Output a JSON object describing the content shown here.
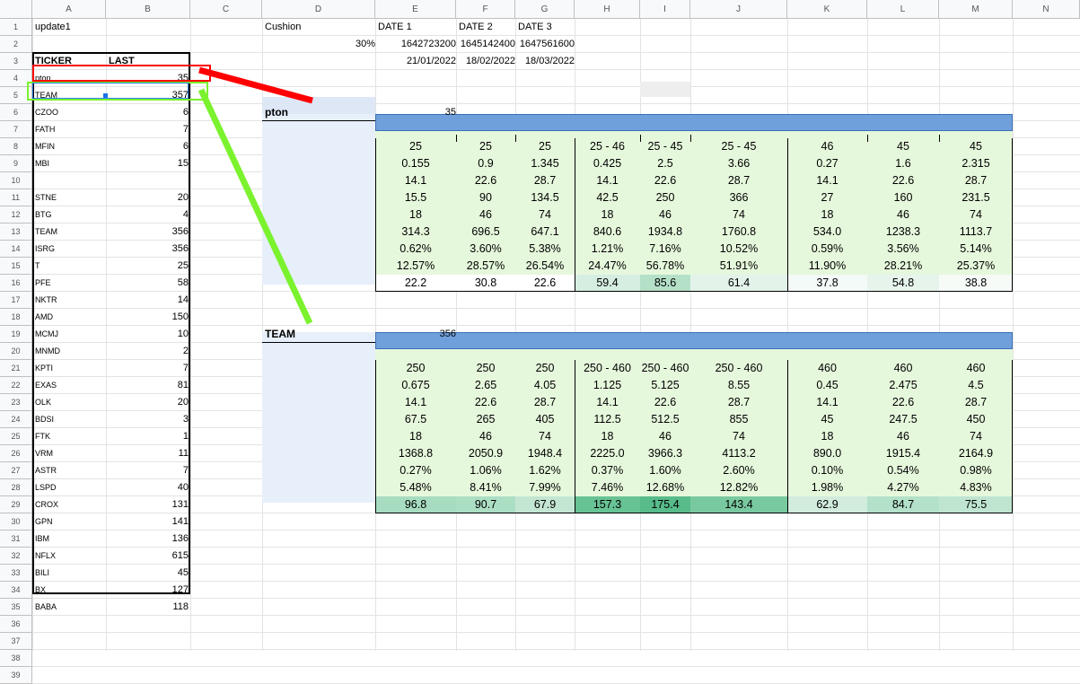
{
  "columns": [
    "A",
    "B",
    "C",
    "D",
    "E",
    "F",
    "G",
    "H",
    "I",
    "J",
    "K",
    "L",
    "M",
    "N"
  ],
  "rows": [
    "1",
    "2",
    "3",
    "4",
    "5",
    "6",
    "7",
    "8",
    "9",
    "10",
    "11",
    "12",
    "13",
    "14",
    "15",
    "16",
    "17",
    "18",
    "19",
    "20",
    "21",
    "22",
    "23",
    "24",
    "25",
    "26",
    "27",
    "28",
    "29",
    "30",
    "31",
    "32",
    "33",
    "34",
    "35",
    "36",
    "37",
    "38",
    "39"
  ],
  "sheet_name": "update1",
  "ticker_header": "TICKER",
  "last_header": "LAST",
  "tickers": [
    {
      "t": "pton",
      "v": "35"
    },
    {
      "t": "TEAM",
      "v": "357"
    },
    {
      "t": "CZOO",
      "v": "6"
    },
    {
      "t": "FATH",
      "v": "7"
    },
    {
      "t": "MFIN",
      "v": "6"
    },
    {
      "t": "MBI",
      "v": "15"
    },
    {
      "t": "",
      "v": ""
    },
    {
      "t": "STNE",
      "v": "20"
    },
    {
      "t": "BTG",
      "v": "4"
    },
    {
      "t": "TEAM",
      "v": "356"
    },
    {
      "t": "ISRG",
      "v": "356"
    },
    {
      "t": "T",
      "v": "25"
    },
    {
      "t": "PFE",
      "v": "58"
    },
    {
      "t": "NKTR",
      "v": "14"
    },
    {
      "t": "AMD",
      "v": "150"
    },
    {
      "t": "MCMJ",
      "v": "10"
    },
    {
      "t": "MNMD",
      "v": "2"
    },
    {
      "t": "KPTI",
      "v": "7"
    },
    {
      "t": "EXAS",
      "v": "81"
    },
    {
      "t": "OLK",
      "v": "20"
    },
    {
      "t": "BDSI",
      "v": "3"
    },
    {
      "t": "FTK",
      "v": "1"
    },
    {
      "t": "VRM",
      "v": "11"
    },
    {
      "t": "ASTR",
      "v": "7"
    },
    {
      "t": "LSPD",
      "v": "40"
    },
    {
      "t": "CROX",
      "v": "131"
    },
    {
      "t": "GPN",
      "v": "141"
    },
    {
      "t": "IBM",
      "v": "136"
    },
    {
      "t": "NFLX",
      "v": "615"
    },
    {
      "t": "BILI",
      "v": "45"
    },
    {
      "t": "BX",
      "v": "127"
    },
    {
      "t": "BABA",
      "v": "118"
    }
  ],
  "cushion_label": "Cushion",
  "cushion_value": "30%",
  "dates": [
    {
      "label": "DATE 1",
      "ts": "1642723200",
      "d": "21/01/2022"
    },
    {
      "label": "DATE 2",
      "ts": "1645142400",
      "d": "18/02/2022"
    },
    {
      "label": "DATE 3",
      "ts": "1647561600",
      "d": "18/03/2022"
    }
  ],
  "sections": [
    {
      "name": "pton",
      "value": "35",
      "rows": [
        [
          "25",
          "25",
          "25",
          "25 - 46",
          "25 - 45",
          "25 - 45",
          "46",
          "45",
          "45"
        ],
        [
          "0.155",
          "0.9",
          "1.345",
          "0.425",
          "2.5",
          "3.66",
          "0.27",
          "1.6",
          "2.315"
        ],
        [
          "14.1",
          "22.6",
          "28.7",
          "14.1",
          "22.6",
          "28.7",
          "14.1",
          "22.6",
          "28.7"
        ],
        [
          "15.5",
          "90",
          "134.5",
          "42.5",
          "250",
          "366",
          "27",
          "160",
          "231.5"
        ],
        [
          "18",
          "46",
          "74",
          "18",
          "46",
          "74",
          "18",
          "46",
          "74"
        ],
        [
          "314.3",
          "696.5",
          "647.1",
          "840.6",
          "1934.8",
          "1760.8",
          "534.0",
          "1238.3",
          "1113.7"
        ],
        [
          "0.62%",
          "3.60%",
          "5.38%",
          "1.21%",
          "7.16%",
          "10.52%",
          "0.59%",
          "3.56%",
          "5.14%"
        ],
        [
          "12.57%",
          "28.57%",
          "26.54%",
          "24.47%",
          "56.78%",
          "51.91%",
          "11.90%",
          "28.21%",
          "25.37%"
        ],
        [
          "22.2",
          "30.8",
          "22.6",
          "59.4",
          "85.6",
          "61.4",
          "37.8",
          "54.8",
          "38.8"
        ]
      ],
      "last_colors": [
        "#ffffff",
        "#ffffff",
        "#ffffff",
        "#d6eee2",
        "#b4e0c8",
        "#e3f3ea",
        "#f4faf7",
        "#e6f4ec",
        "#f6fbf8"
      ]
    },
    {
      "name": "TEAM",
      "value": "356",
      "rows": [
        [
          "250",
          "250",
          "250",
          "250 - 460",
          "250 - 460",
          "250 - 460",
          "460",
          "460",
          "460"
        ],
        [
          "0.675",
          "2.65",
          "4.05",
          "1.125",
          "5.125",
          "8.55",
          "0.45",
          "2.475",
          "4.5"
        ],
        [
          "14.1",
          "22.6",
          "28.7",
          "14.1",
          "22.6",
          "28.7",
          "14.1",
          "22.6",
          "28.7"
        ],
        [
          "67.5",
          "265",
          "405",
          "112.5",
          "512.5",
          "855",
          "45",
          "247.5",
          "450"
        ],
        [
          "18",
          "46",
          "74",
          "18",
          "46",
          "74",
          "18",
          "46",
          "74"
        ],
        [
          "1368.8",
          "2050.9",
          "1948.4",
          "2225.0",
          "3966.3",
          "4113.2",
          "890.0",
          "1915.4",
          "2164.9"
        ],
        [
          "0.27%",
          "1.06%",
          "1.62%",
          "0.37%",
          "1.60%",
          "2.60%",
          "0.10%",
          "0.54%",
          "0.98%"
        ],
        [
          "5.48%",
          "8.41%",
          "7.99%",
          "7.46%",
          "12.68%",
          "12.82%",
          "1.98%",
          "4.27%",
          "4.83%"
        ],
        [
          "96.8",
          "90.7",
          "67.9",
          "157.3",
          "175.4",
          "143.4",
          "62.9",
          "84.7",
          "75.5"
        ]
      ],
      "last_colors": [
        "#a7dcc1",
        "#acdec4",
        "#c3e6d3",
        "#67c294",
        "#57bb8a",
        "#79c9a0",
        "#d1ecdd",
        "#b3e1c9",
        "#bfe5d1"
      ]
    }
  ],
  "colors": {
    "green_fill": "#e6f8dc",
    "blue_bar": "#6fa0dc",
    "light_blue": "#e6effa",
    "red_arrow": "#ff0000",
    "green_arrow": "#7bf22e"
  }
}
